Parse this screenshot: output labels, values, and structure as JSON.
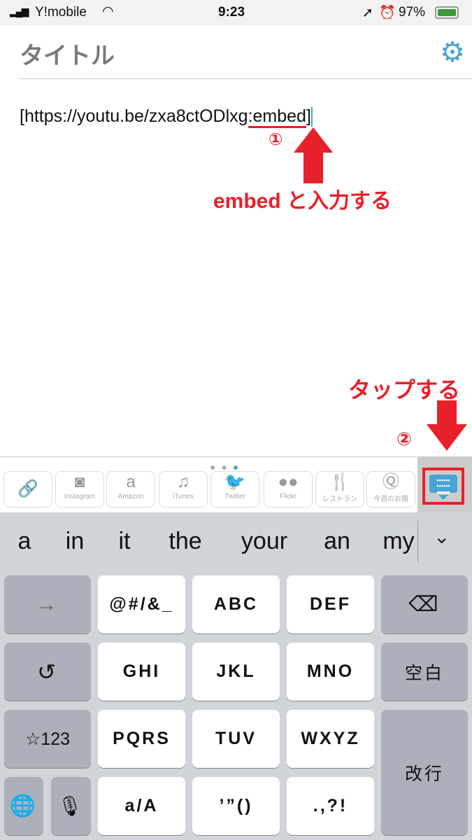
{
  "status": {
    "carrier": "Y!mobile",
    "time": "9:23",
    "battery": "97%"
  },
  "header": {
    "title": "タイトル",
    "settings_icon": "gear-icon"
  },
  "editor": {
    "prefix": "[https://youtu.be/zxa8ctODlxg",
    "typed": ":embed",
    "suffix": "]"
  },
  "annotations": {
    "step1": "①",
    "step1_text": "embed と入力する",
    "step2": "②",
    "step2_text": "タップする",
    "color": "#e8202a"
  },
  "toolbar": {
    "items": [
      {
        "label": "",
        "icon": "link-icon"
      },
      {
        "label": "Instagram",
        "icon": "instagram-icon"
      },
      {
        "label": "Amazon",
        "icon": "amazon-icon"
      },
      {
        "label": "iTunes",
        "icon": "music-note-icon"
      },
      {
        "label": "Twitter",
        "icon": "twitter-bird-icon"
      },
      {
        "label": "Flickr",
        "icon": "flickr-dots-icon"
      },
      {
        "label": "レストラン",
        "icon": "fork-knife-icon"
      },
      {
        "label": "今週のお題",
        "icon": "q-pin-icon"
      }
    ],
    "page": 3,
    "pages": 3,
    "accent": "#4aa3d6"
  },
  "keyboard": {
    "suggestions": [
      "a",
      "in",
      "it",
      "the",
      "your",
      "an",
      "my"
    ],
    "keys": {
      "arrow": "→",
      "k1": "@#/&_",
      "k2": "ABC",
      "k3": "DEF",
      "undo": "↺",
      "k4": "GHI",
      "k5": "JKL",
      "k6": "MNO",
      "space": "空白",
      "num": "☆123",
      "k7": "PQRS",
      "k8": "TUV",
      "k9": "WXYZ",
      "enter": "改行",
      "k10": "a/A",
      "k11": "’”()",
      "k12": ".,?!"
    }
  }
}
